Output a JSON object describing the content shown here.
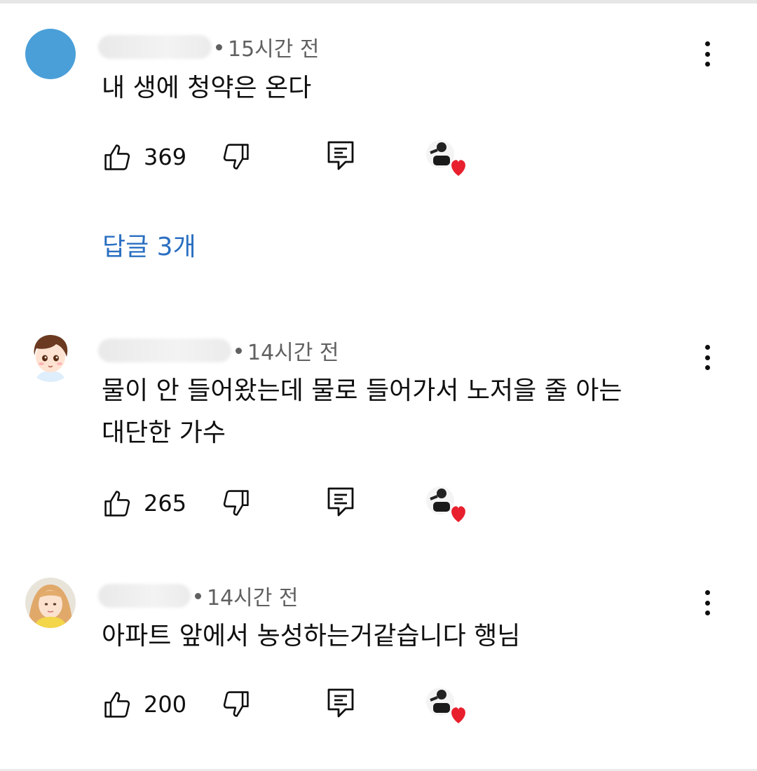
{
  "comments": [
    {
      "time": "15시간 전",
      "text": "내 생에 청약은 온다",
      "likes": "369",
      "avatar": "blue-circle-avatar"
    },
    {
      "time": "14시간 전",
      "text_line1": "물이 안 들어왔는데 물로 들어가서 노저을 줄 아는",
      "text_line2": "대단한 가수",
      "likes": "265",
      "avatar": "cartoon-boy-avatar"
    },
    {
      "time": "14시간 전",
      "text": "아파트 앞에서 농성하는거같습니다 행님",
      "likes": "200",
      "avatar": "photo-avatar"
    }
  ],
  "replies_link": "답글 3개",
  "colors": {
    "link": "#2a6fc1",
    "heart": "#e8202e",
    "meta": "#606060"
  }
}
